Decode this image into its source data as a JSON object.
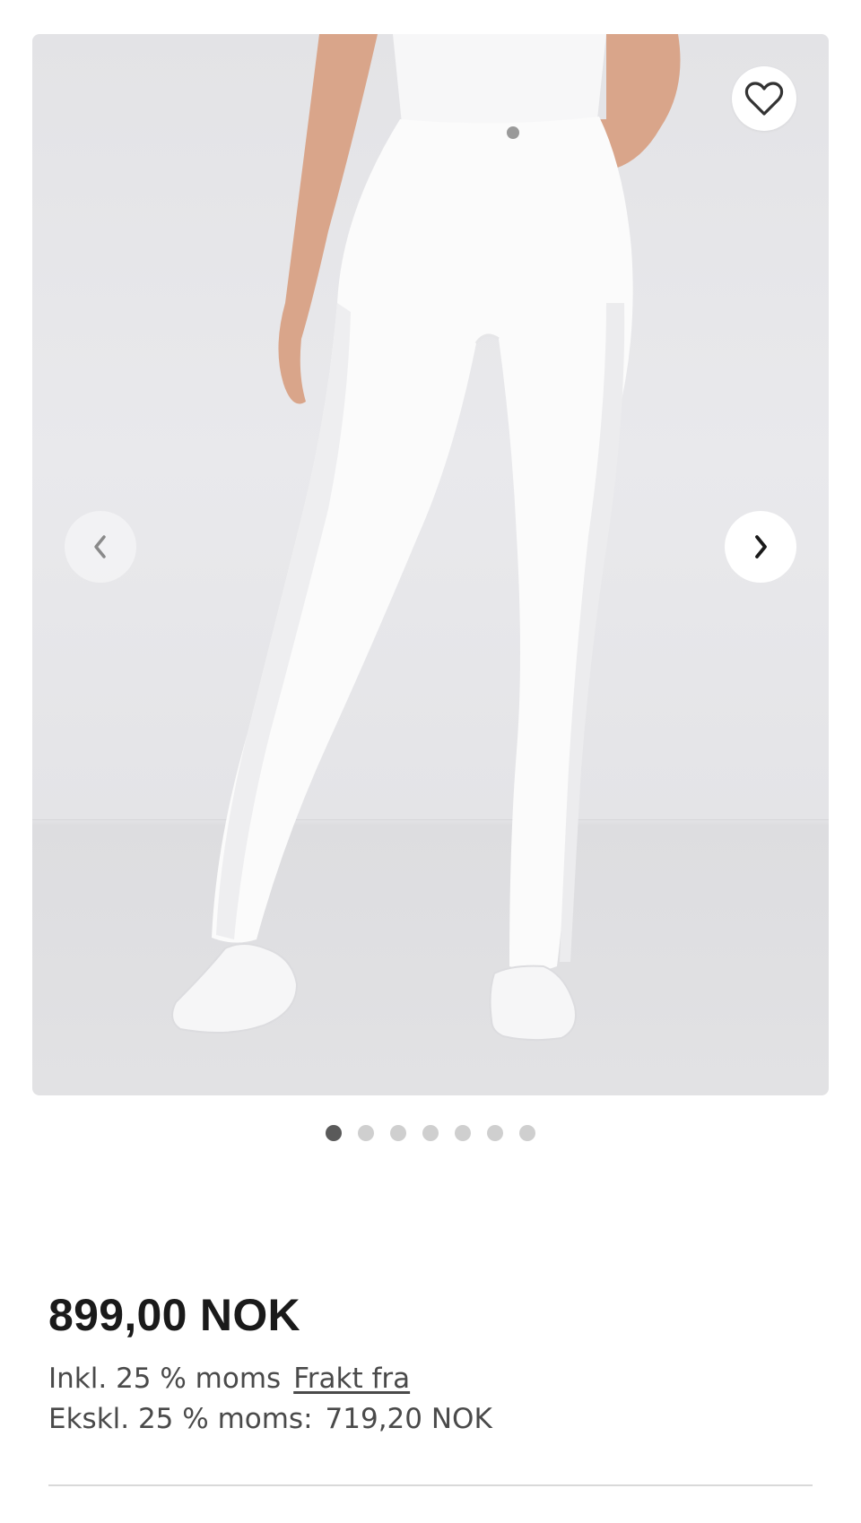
{
  "gallery": {
    "image_alt": "White slim-fit trousers worn by a model with white sneakers",
    "dots_count": 7,
    "active_index": 0,
    "icons": {
      "favorite": "heart-icon",
      "prev": "chevron-left-icon",
      "next": "chevron-right-icon"
    }
  },
  "product": {
    "price": "899,00 NOK",
    "incl_vat": "Inkl. 25 % moms",
    "shipping_link": "Frakt fra",
    "excl_vat_label": "Ekskl. 25 % moms:",
    "excl_vat_value": "719,20 NOK"
  },
  "colors": {
    "background": "#ffffff",
    "text": "#1a1a1a",
    "muted_text": "#4a4a4a",
    "active_dot": "#5a5a5a",
    "inactive_dot": "#cfcfcf"
  }
}
